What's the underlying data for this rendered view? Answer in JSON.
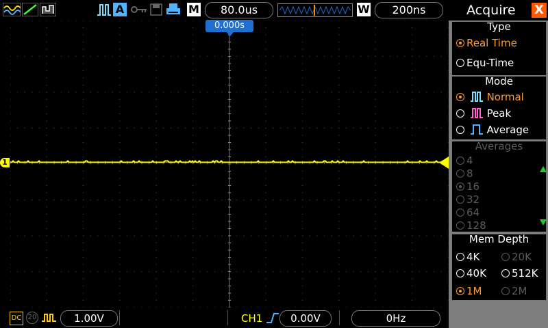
{
  "top": {
    "mode_letter": "A",
    "m_label": "M",
    "timebase": "80.0us",
    "w_label": "W",
    "window_time": "200ns"
  },
  "trigger_time": "0.000s",
  "channel_marker": "1",
  "bottom": {
    "coupling": "DC",
    "bw": "20",
    "volts": "1.00V",
    "trigger_source": "CH1",
    "trigger_level": "0.00V",
    "frequency": "0Hz"
  },
  "menu": {
    "title": "Acquire",
    "close": "X",
    "type": {
      "title": "Type",
      "options": [
        "Real Time",
        "Equ-Time"
      ],
      "selected": 0
    },
    "mode": {
      "title": "Mode",
      "options": [
        "Normal",
        "Peak",
        "Average"
      ],
      "selected": 0
    },
    "averages": {
      "title": "Averages",
      "options": [
        "4",
        "8",
        "16",
        "32",
        "64",
        "128"
      ],
      "selected": 2
    },
    "mem": {
      "title": "Mem Depth",
      "options": [
        "4K",
        "20K",
        "40K",
        "512K",
        "1M",
        "2M"
      ],
      "selected": 4
    }
  },
  "colors": {
    "trace": "#ffff00",
    "accent": "#ff9a2a",
    "trigger_blue": "#1f6fd0"
  }
}
